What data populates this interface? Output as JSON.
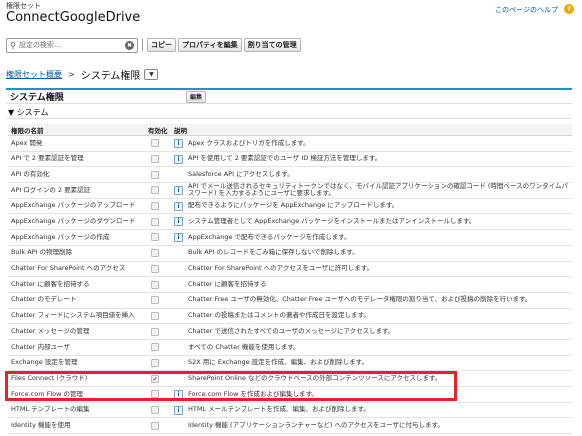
{
  "header": {
    "eyebrow": "権限セット",
    "title": "ConnectGoogleDrive",
    "help_link": "このページのヘルプ",
    "help_icon": "question-mark-icon"
  },
  "toolbar": {
    "search_placeholder": "設定の検索...",
    "search_icon": "search-icon",
    "clear_icon": "clear-icon",
    "buttons": [
      "コピー",
      "プロパティを編集",
      "割り当ての管理"
    ]
  },
  "breadcrumb": {
    "link": "権限セット概要",
    "separator": ">",
    "current": "システム権限",
    "dropdown_icon": "chevron-down-icon"
  },
  "section": {
    "title": "システム権限",
    "edit_label": "編集",
    "subsection": "▼ システム"
  },
  "table": {
    "headers": [
      "権限の名前",
      "有効化",
      "説明"
    ],
    "rows": [
      {
        "name": "Apex 開発",
        "info": true,
        "checked": false,
        "desc": "Apex クラスおよびトリガを作成します。"
      },
      {
        "name": "API で 2 要素認証を管理",
        "info": true,
        "checked": false,
        "desc": "API を使用して 2 要素認証でのユーザ ID 検証方法を管理します。"
      },
      {
        "name": "API の有効化",
        "info": false,
        "checked": false,
        "desc": "Salesforce API にアクセスします。"
      },
      {
        "name": "API ログインの 2 要素認証",
        "info": true,
        "checked": false,
        "desc": "API でメール送信されるセキュリティトークンではなく、モバイル認証アプリケーションの確認コード (時間ベースのワンタイムパスワード) を入力するようにユーザに要求します。"
      },
      {
        "name": "AppExchange パッケージのアップロード",
        "info": true,
        "checked": false,
        "desc": "配布できるようにパッケージを AppExchange にアップロードします。"
      },
      {
        "name": "AppExchange パッケージのダウンロード",
        "info": true,
        "checked": false,
        "desc": "システム管理者として AppExchange パッケージをインストールまたはアンインストールします。"
      },
      {
        "name": "AppExchange パッケージの作成",
        "info": true,
        "checked": false,
        "desc": "AppExchange で配布できるパッケージを作成します。"
      },
      {
        "name": "Bulk API の物理削除",
        "info": false,
        "checked": false,
        "desc": "Bulk API のレコードをごみ箱に保存しないで削除します。"
      },
      {
        "name": "Chatter For SharePoint へのアクセス",
        "info": false,
        "checked": false,
        "desc": "Chatter For SharePoint へのアクセスをユーザに許可します。"
      },
      {
        "name": "Chatter に顧客を招待する",
        "info": false,
        "checked": false,
        "desc": "Chatter に顧客を招待する"
      },
      {
        "name": "Chatter のモデレート",
        "info": false,
        "checked": false,
        "desc": "Chatter Free ユーザの無効化、Chatter Free ユーザへのモデレータ権限の割り当て、および投稿の削除を行います。"
      },
      {
        "name": "Chatter フィードにシステム項目値を挿入",
        "info": false,
        "checked": false,
        "desc": "Chatter の投稿またはコメントの著者や作成日を設定します。"
      },
      {
        "name": "Chatter メッセージの管理",
        "info": false,
        "checked": false,
        "desc": "Chatter で送信されたすべてのユーザのメッセージにアクセスします。"
      },
      {
        "name": "Chatter 内部ユーザ",
        "info": false,
        "checked": false,
        "desc": "すべての Chatter 機能を使用します。"
      },
      {
        "name": "Exchange 設定を管理",
        "info": false,
        "checked": false,
        "desc": "S2X 用に Exchange 設定を作成、編集、および削除します。"
      },
      {
        "name": "Files Connect (クラウド)",
        "info": false,
        "checked": true,
        "desc": "SharePoint Online などのクラウドベースの外部コンテンツソースにアクセスします。"
      },
      {
        "name": "Force.com Flow の管理",
        "info": true,
        "checked": false,
        "desc": "Force.com Flow を作成および編集します。"
      },
      {
        "name": "HTML テンプレートの編集",
        "info": true,
        "checked": false,
        "desc": "HTML メールテンプレートを作成、編集、および削除します。"
      },
      {
        "name": "Identity 機能を使用",
        "info": false,
        "checked": false,
        "desc": "Identity 機能 (アプリケーションランチャーなど) へのアクセスをユーザに付与します。"
      }
    ]
  },
  "colors": {
    "accent": "#1797c0",
    "link": "#015ba7",
    "highlight": "#e8202a"
  }
}
